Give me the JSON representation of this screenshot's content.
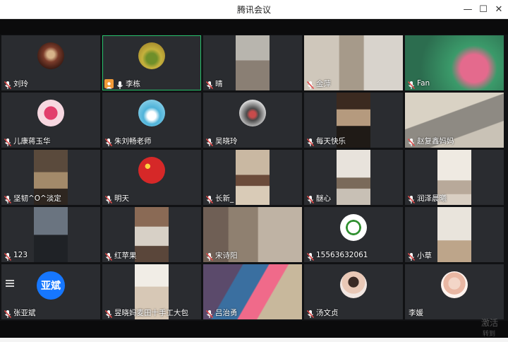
{
  "window": {
    "title": "腾讯会议",
    "minimize_glyph": "—",
    "maximize_glyph": "☐",
    "close_glyph": "✕"
  },
  "colors": {
    "stage": "#111214",
    "tile": "#2a2c30",
    "active_border": "#27c06b",
    "host_badge": "#f29b38",
    "mic_muted": "#e24b4b",
    "text_avatar": "#1677ff"
  },
  "participants": [
    {
      "name": "刘玲",
      "mic": "muted",
      "type": "avatar"
    },
    {
      "name": "李栋",
      "mic": "on",
      "host": true,
      "type": "avatar",
      "active": true
    },
    {
      "name": "晴",
      "mic": "muted",
      "type": "video"
    },
    {
      "name": "金萍",
      "mic": "muted",
      "type": "video"
    },
    {
      "name": "Fan",
      "mic": "muted",
      "type": "video"
    },
    {
      "name": "儿康蒋玉华",
      "mic": "muted",
      "type": "avatar"
    },
    {
      "name": "朱刘畅老师",
      "mic": "muted",
      "type": "avatar"
    },
    {
      "name": "吴晓玲",
      "mic": "muted",
      "type": "avatar"
    },
    {
      "name": "每天快乐",
      "mic": "muted",
      "type": "video"
    },
    {
      "name": "赵复鑫妈妈",
      "mic": "muted",
      "type": "video"
    },
    {
      "name": "坚韧^O^淡定",
      "mic": "muted",
      "type": "video"
    },
    {
      "name": "明天",
      "mic": "muted",
      "type": "avatar"
    },
    {
      "name": "长新_",
      "mic": "muted",
      "type": "video"
    },
    {
      "name": "醚心",
      "mic": "muted",
      "type": "video"
    },
    {
      "name": "润泽晨曦",
      "mic": "muted",
      "type": "video"
    },
    {
      "name": "123",
      "mic": "muted",
      "type": "video"
    },
    {
      "name": "红苹果",
      "mic": "muted",
      "type": "video"
    },
    {
      "name": "宋诗阳",
      "mic": "muted",
      "type": "video"
    },
    {
      "name": "15563632061",
      "mic": "muted",
      "type": "avatar"
    },
    {
      "name": "小草",
      "mic": "muted",
      "type": "video"
    },
    {
      "name": "张亚斌",
      "mic": "muted",
      "type": "text-avatar",
      "avatar_text": "亚斌"
    },
    {
      "name": "昱晓妈麦田十手工大包",
      "mic": "muted",
      "type": "video"
    },
    {
      "name": "吕治勇",
      "mic": "muted",
      "type": "video"
    },
    {
      "name": "汤文贞",
      "mic": "muted",
      "type": "avatar"
    },
    {
      "name": "李媛",
      "mic": "none",
      "type": "avatar"
    }
  ],
  "watermark": {
    "line1": "激活",
    "line2": "转到"
  }
}
